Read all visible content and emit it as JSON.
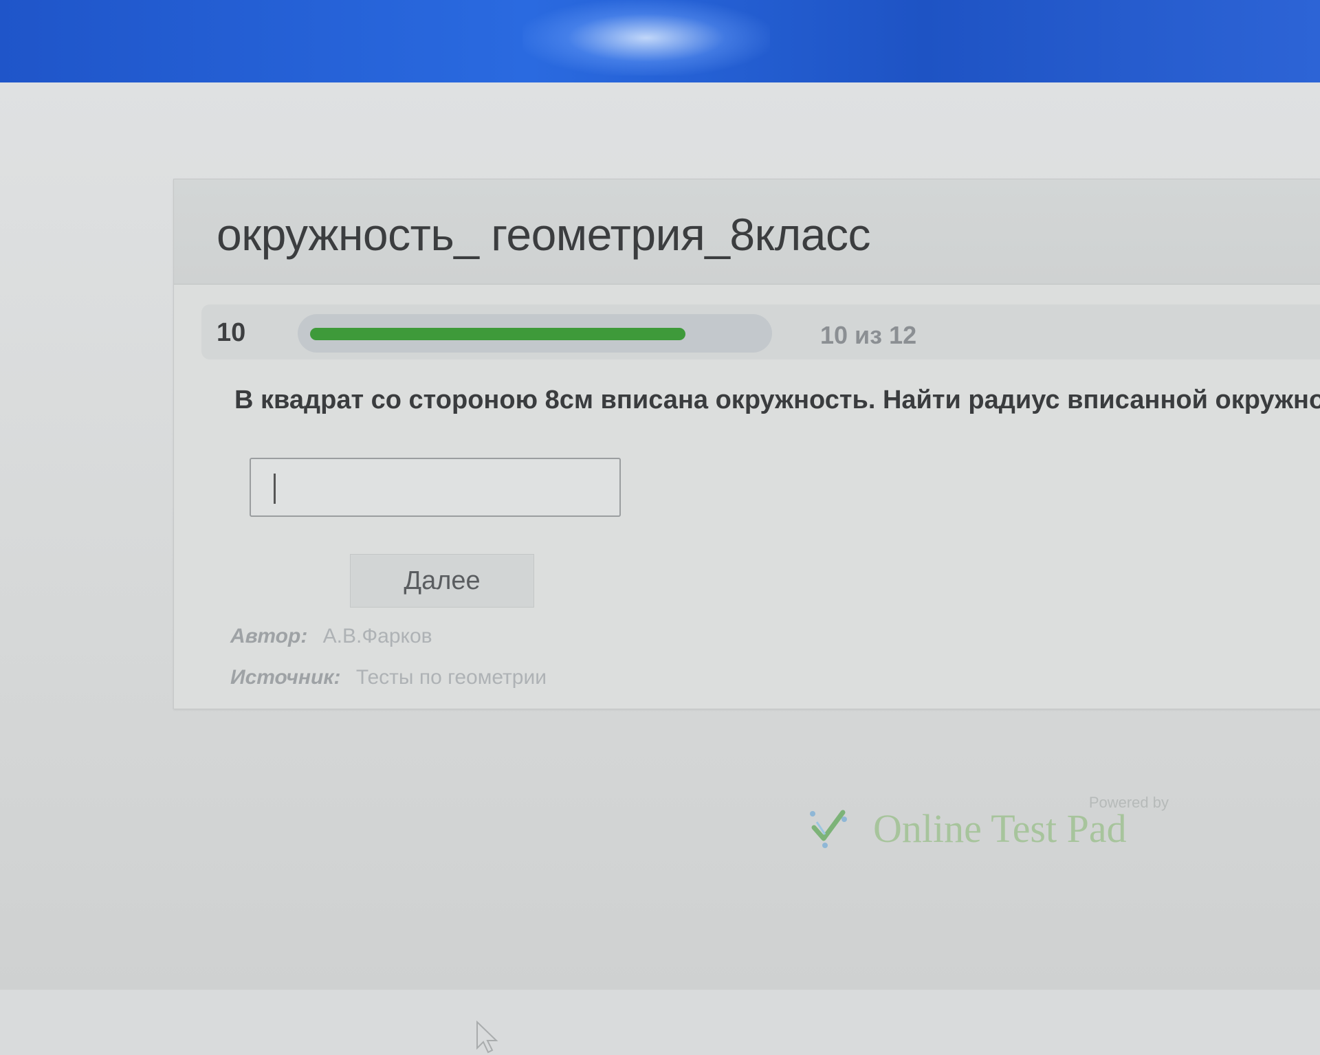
{
  "test": {
    "title": "окружность_ геометрия_8класс"
  },
  "progress": {
    "question_number": "10",
    "current": 10,
    "total": 12,
    "text": "10 из 12",
    "fraction": 0.8333,
    "bar_color": "#3e9a3a"
  },
  "question": {
    "text": "В квадрат со стороною 8см вписана окружность. Найти радиус вписанной окружно"
  },
  "answer": {
    "value": "",
    "placeholder": ""
  },
  "buttons": {
    "next_label": "Далее"
  },
  "meta": {
    "author_label": "Автор:",
    "author_value": "А.В.Фарков",
    "source_label": "Источник:",
    "source_value": "Тесты по геометрии"
  },
  "footer": {
    "powered_by": "Powered by",
    "brand": "Online Test Pad",
    "brand_color": "#a7c49c"
  },
  "icons": {
    "logo": "checkmark-logo-icon",
    "cursor": "mouse-pointer-icon"
  }
}
